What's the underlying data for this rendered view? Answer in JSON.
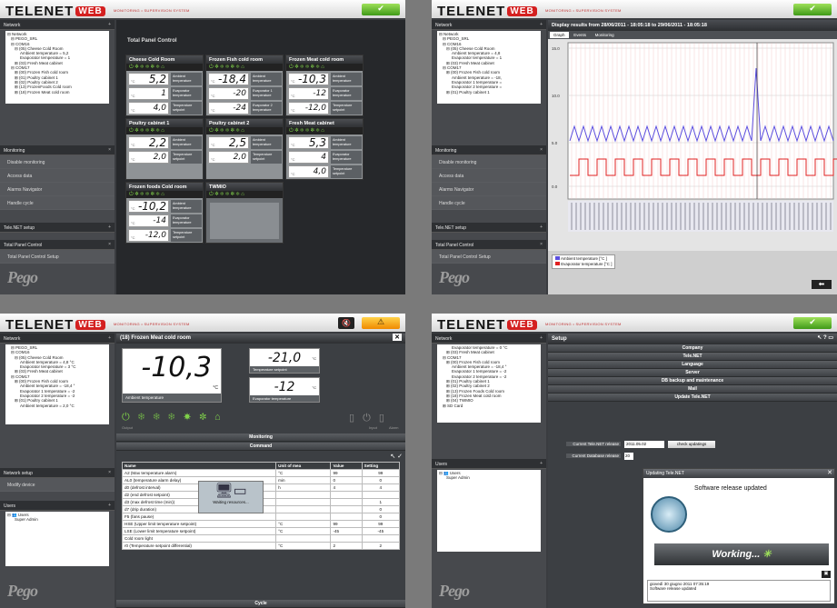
{
  "brand": {
    "logo": "TELENET",
    "logo_web": "WEB",
    "tagline": "MONITORING • SUPERVISION SYSTEM",
    "pego": "Pego"
  },
  "panel1": {
    "side": {
      "network": "Network",
      "monitoring": "Monitoring",
      "telenet_setup": "Tele.NET setup",
      "total_panel": "Total Panel Control"
    },
    "tree": [
      "⊟ Network",
      "⊟ PEGO_SRL",
      "⊟ COM16",
      "⊟ (05) Cheese Cold Room",
      "Ambient temperature = 5,2",
      "Evaporator temperature = 1",
      "⊞ (03) Fresh Meat cabinet",
      "⊟ COM17",
      "⊞ (00) Frozen Fish cold room",
      "⊞ (01) Poultry cabinet 1",
      "⊞ (02) Poultry cabinet 2",
      "⊞ (13) FrozenFoods Cold room",
      "⊞ (18) Frozen Meat cold room"
    ],
    "menu": [
      "Disable monitoring",
      "Access data",
      "Alarms Navigator",
      "Handle cycle"
    ],
    "total_item": "Total Panel Control Setup",
    "title": "Total Panel Control",
    "cards": [
      {
        "name": "Cheese Cold Room",
        "v1": "5,2",
        "v2": "1",
        "v3": "4,0",
        "l1": "Ambient temperature",
        "l2": "Evaporator temperature",
        "l3": "Temperature setpoint"
      },
      {
        "name": "Frozen Fish cold room",
        "v1": "-18,4",
        "v2": "-20",
        "v3": "-24",
        "l1": "Ambient temperature",
        "l2": "Evaporator 1 temperature",
        "l3": "Evaporator 2 temperature"
      },
      {
        "name": "Frozen Meat cold room",
        "v1": "-10,3",
        "v2": "-12",
        "v3": "-12,0",
        "l1": "Ambient temperature",
        "l2": "Evaporator temperature",
        "l3": "Temperature setpoint"
      },
      {
        "name": "Poultry cabinet 1",
        "v1": "2,2",
        "v2": "2,0",
        "l1": "Ambient temperature",
        "l2": "Temperature setpoint"
      },
      {
        "name": "Poultry cabinet 2",
        "v1": "2,5",
        "v2": "2,0",
        "l1": "Ambient temperature",
        "l2": "Temperature setpoint"
      },
      {
        "name": "Fresh Meat cabinet",
        "v1": "5,3",
        "v2": "4",
        "v3": "4,0",
        "l1": "Ambient temperature",
        "l2": "Evaporator temperature",
        "l3": "Temperature setpoint"
      },
      {
        "name": "Frozen foods Cold room",
        "v1": "-10,2",
        "v2": "-14",
        "v3": "-12,0",
        "l1": "Ambient temperature",
        "l2": "Evaporator temperature",
        "l3": "Temperature setpoint"
      },
      {
        "name": "TWMIO"
      }
    ]
  },
  "panel2": {
    "title": "Display results from 28/06/2011 - 18:05:18 to 29/06/2011 - 18:05:18",
    "tabs": [
      "Graph",
      "Events",
      "Monitoring"
    ],
    "tree": [
      "⊟ Network",
      "⊟ PEGO_SRL",
      "⊟ COM16",
      "⊟ (05) Cheese Cold Room",
      "Ambient temperature = 4,8",
      "Evaporator temperature = 1",
      "⊞ (03) Fresh Meat cabinet",
      "⊟ COM17",
      "⊞ (00) Frozen Fish cold room",
      "Ambient temperature = -18,",
      "Evaporator 1 temperature =",
      "Evaporator 2 temperature =",
      "⊞ (01) Poultry cabinet 1"
    ],
    "ylabels": [
      "15.0",
      "10.0",
      "5.0",
      "0.0"
    ],
    "legend": [
      "Ambient temperature [°C    ]",
      "Evaporator temperature [°C    ]"
    ],
    "colors": {
      "ambient": "#5a4ee0",
      "evap": "#e02020"
    }
  },
  "panel3": {
    "title": "(18) Frozen Meat cold room",
    "big": "-10,3",
    "big_unit": "°C",
    "big_label": "Ambient temperature",
    "setpoint": "-21,0",
    "setpoint_label": "Temperature setpoint",
    "evap": "-12",
    "evap_label": "Evaporator temperature",
    "unit": "°C",
    "tree": [
      "⊟ PEGO_SRL",
      "⊟ COM16",
      "⊟ (05) Cheese Cold Room",
      "Ambient temperature = 4,8 °C",
      "Evaporator temperature = 3 °C",
      "⊞ (03) Fresh Meat cabinet",
      "⊟ COM17",
      "⊞ (00) Frozen Fish cold room",
      "Ambient temperature = -18,4 °",
      "Evaporator 1 temperature = -2",
      "Evaporator 2 temperature = -2",
      "⊞ (01) Poultry cabinet 1",
      "Ambient temperature = 2,0 °C"
    ],
    "side": {
      "network": "Network",
      "setup": "Network setup",
      "modify": "Modify device",
      "users": "Users",
      "users_root": "Users",
      "user": "Super Admin"
    },
    "bars": {
      "monitoring": "Monitoring",
      "command": "Command",
      "cycle": "Cycle"
    },
    "cols": [
      "Name",
      "Unit of mea",
      "Value",
      "Setting"
    ],
    "rows": [
      [
        "A2 (Max temperature alarm)",
        "°C",
        "99",
        "99"
      ],
      [
        "AL0 (temperature alarm delay)",
        "min",
        "0",
        "0"
      ],
      [
        "d0 (defrost interval)",
        "h",
        "4",
        "4"
      ],
      [
        "d2 (end defrost setpoint)",
        "",
        "",
        ""
      ],
      [
        "d3 (max defrost time (min))",
        "",
        "",
        "1"
      ],
      [
        "d7 (drip duration)",
        "",
        "",
        "0"
      ],
      [
        "F5 (fans pause)",
        "",
        "",
        "0"
      ],
      [
        "HSE (Upper limit temperature setpoint)",
        "°C",
        "99",
        "99"
      ],
      [
        "LSE (Lower limit temperature setpoint)",
        "°C",
        "-45",
        "-45"
      ],
      [
        "Cold room light",
        "",
        "",
        ""
      ],
      [
        "r0 (Temperature setpoint differential)",
        "°C",
        "2",
        "2"
      ]
    ],
    "waiting": "Waiting resources...",
    "labels": {
      "output": "Output",
      "input": "Input",
      "alarm": "Alarm"
    }
  },
  "panel4": {
    "title": "Setup",
    "tree": [
      "Evaporator temperature = 0 °C",
      "⊞ (03) Fresh Meat cabinet",
      "⊟ COM17",
      "⊞ (00) Frozen Fish cold room",
      "Ambient temperature = -18,4 °",
      "Evaporator 1 temperature = -2",
      "Evaporator 2 temperature = -2",
      "⊞ (01) Poultry cabinet 1",
      "⊞ (02) Poultry cabinet 2",
      "⊞ (13) Frozen Foods Cold room",
      "⊞ (18) Frozen Meat cold room",
      "⊞ (04) TWMIO",
      "⊞ SD Card"
    ],
    "side": {
      "network": "Network",
      "users": "Users",
      "users_root": "Users",
      "user": "Super Admin"
    },
    "sections": [
      "Company",
      "Tele.NET",
      "Language",
      "Server",
      "DB backup and maintenance",
      "Mail",
      "Update Tele.NET"
    ],
    "cur_rel_label": "Current Tele.NET release",
    "cur_rel": "2011.05.02",
    "check": "check updatings",
    "cur_db_label": "Current Database release",
    "cur_db": "20",
    "dlg_title": "Updating Tele.NET",
    "dlg_msg": "Software release updated",
    "working": "Working...",
    "log1": "giovedì 30 giugno 2011 07:35:19",
    "log2": "Software release updated"
  }
}
